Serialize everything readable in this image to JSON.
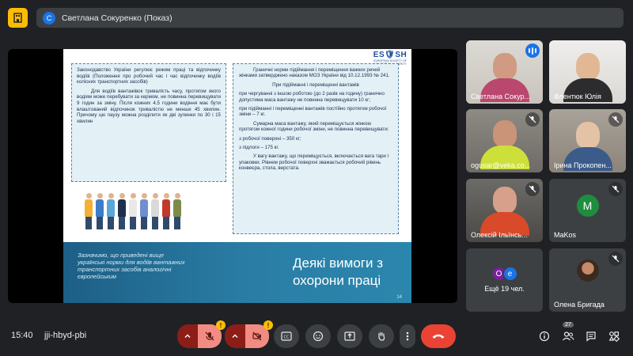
{
  "presenter_chip": {
    "avatar_letter": "С",
    "title": "Светлана Сокуренко (Показ)"
  },
  "slide": {
    "logo": "ES🛡SH",
    "logo_text": "EUROPEAN SOCIETY OF OCCUPATIONAL SAFETY",
    "left_box": {
      "p1": "Законодавство України регулює режим праці та відпочинку водіїв (Положення про робочий час і час відпочинку водіїв колісних транспортних засобів)",
      "p2": "Для водіїв вантажівок тривалість часу, протягом якого водіям може перебувати за кермом, не повинна перевищувати 9 годин за зміну. Після кожних 4,5 години водіння має бути влаштований відпочинок тривалістю не менше 45 хвилин. Причому цю паузу можна розділити як дві зупинки по 30 і 15 хвилин"
    },
    "right_box": {
      "p1": "Граничні норми підіймання і переміщення важких речей жінками затверджено наказом МОЗ України від 10.12.1993 № 241.",
      "p2": "При підійманні і переміщенні вантажів",
      "p3": "при чергуванні з іншою роботою (до 2 разів на годину) гранично допустима маса вантажу не повинна перевищувати 10 кг;",
      "p4": "при підійманні і переміщенні вантажів постійно протягом робочої зміни – 7 кг.",
      "p5": "Сумарна маса вантажу, який переміщується жінкою протягом кожної години робочої зміни, не повинна перевищувати:",
      "p6": "з робочої поверхні – 350 кг;",
      "p7": "з підлоги – 175 кг.",
      "p8": "У вагу вантажу, що переміщується, включається вага тари і упаковки. Рівнем робочої поверхні зважається робочий рівень конвеєра, стола, верстата."
    },
    "footer_note": "Зазначимо, що приведені вище українські норми для водіїв вантажних транспортних засобів аналогічні європейським",
    "footer_title": "Деякі вимоги з охорони праці",
    "page_number": "14"
  },
  "participants": [
    {
      "name": "Светлана Сокур...",
      "speaking": true
    },
    {
      "name": "Флентюк Юлія"
    },
    {
      "name": "ogusar@veka.co..."
    },
    {
      "name": "Ірина Прокопен..."
    },
    {
      "name": "Олексій Ільїнсь..."
    },
    {
      "name": "MaKos",
      "avatar_letter": "M"
    },
    {
      "name": "Ещё 19 чел.",
      "avatar_letters": [
        "О",
        "e"
      ]
    },
    {
      "name": "Олена Бригада"
    }
  ],
  "bottom_bar": {
    "time": "15:40",
    "meeting_code": "jji-hbyd-pbi",
    "participant_count": "27"
  },
  "colors": {
    "accent": "#8ab4f8",
    "danger": "#ea4335",
    "warning": "#fbbc04",
    "background": "#202124"
  }
}
